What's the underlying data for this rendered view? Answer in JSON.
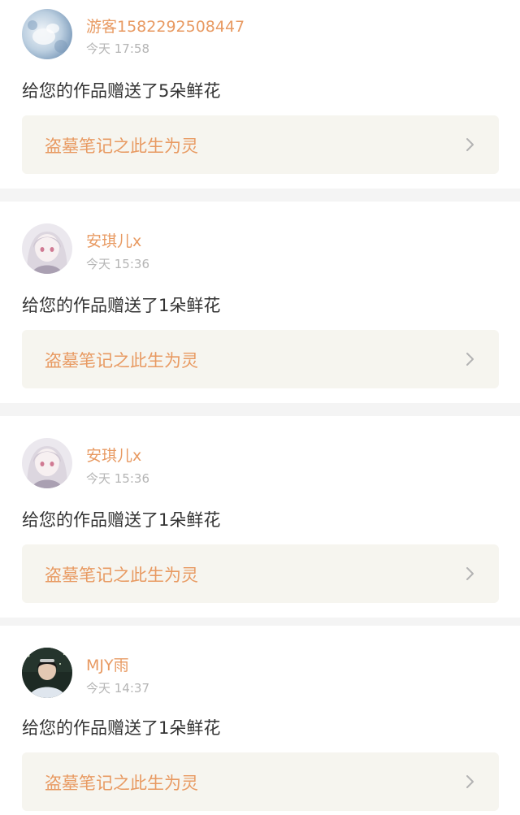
{
  "notifications": [
    {
      "username": "游客1582292508447",
      "timestamp": "今天 17:58",
      "message": "给您的作品赠送了5朵鲜花",
      "work_title": "盗墓笔记之此生为灵",
      "avatar_icon": "guest-avatar"
    },
    {
      "username": "安琪儿x",
      "timestamp": "今天 15:36",
      "message": "给您的作品赠送了1朵鲜花",
      "work_title": "盗墓笔记之此生为灵",
      "avatar_icon": "anime-girl-avatar"
    },
    {
      "username": "安琪儿x",
      "timestamp": "今天 15:36",
      "message": "给您的作品赠送了1朵鲜花",
      "work_title": "盗墓笔记之此生为灵",
      "avatar_icon": "anime-girl-avatar"
    },
    {
      "username": "MJY雨",
      "timestamp": "今天 14:37",
      "message": "给您的作品赠送了1朵鲜花",
      "work_title": "盗墓笔记之此生为灵",
      "avatar_icon": "photo-avatar"
    }
  ],
  "colors": {
    "accent": "#e89a62",
    "timestamp": "#b5b5b5",
    "text": "#333333",
    "link_bg": "#f6f5ef",
    "divider": "#f4f4f4"
  },
  "icons": {
    "chevron": "chevron-right-icon"
  }
}
